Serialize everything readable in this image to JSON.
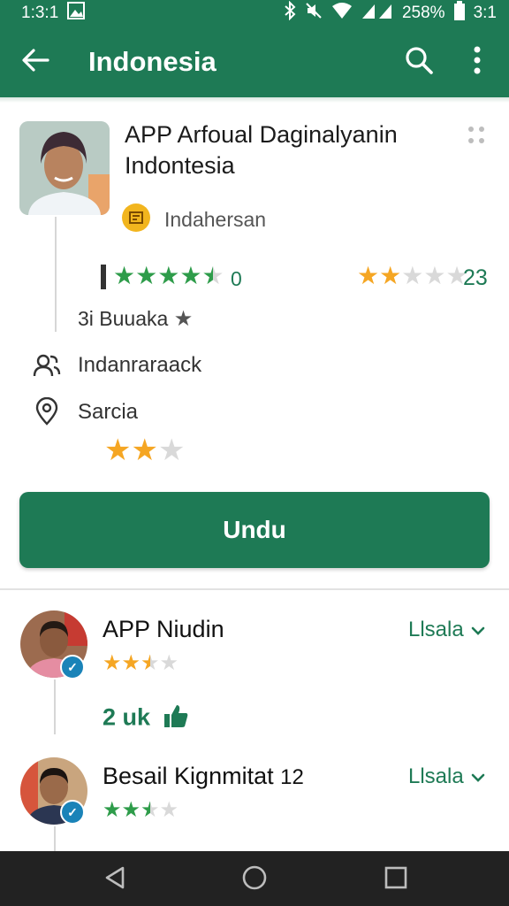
{
  "status_bar": {
    "time": "1:3:1",
    "battery": "258%",
    "clock_right": "3:1"
  },
  "app_bar": {
    "title": "Indonesia"
  },
  "app": {
    "title": "APP Arfoual Daginalyanin Indontesia",
    "developer": "Indahersan",
    "rating_left_value": "0",
    "rating_left_stars": 4.5,
    "rating_right_value": "23",
    "rating_right_stars": 2,
    "downloads": "3i Buuaka",
    "info_people": "Indanraraack",
    "info_location": "Sarcia",
    "info_stars": 2
  },
  "install": {
    "label": "Undu"
  },
  "reviews": [
    {
      "name": "APP Niudin",
      "action": "Llsala",
      "stars": 2.5,
      "likes": "2 uk"
    },
    {
      "name": "Besail Kignmitat",
      "name_suffix": "12",
      "action": "Llsala",
      "stars": 2.5
    }
  ],
  "colors": {
    "primary": "#1e7a55",
    "star_gold": "#f5a623",
    "star_green": "#2e9c4a",
    "star_empty": "#d9d9d9",
    "badge_blue": "#1a83b8"
  },
  "icons": {
    "back": "arrow-left-icon",
    "search": "search-icon",
    "more": "more-vert-icon",
    "people": "people-icon",
    "location": "location-pin-icon",
    "thumbs_up": "thumb-up-icon",
    "nav_back": "nav-back-icon",
    "nav_home": "nav-home-icon",
    "nav_recent": "nav-recent-icon"
  }
}
